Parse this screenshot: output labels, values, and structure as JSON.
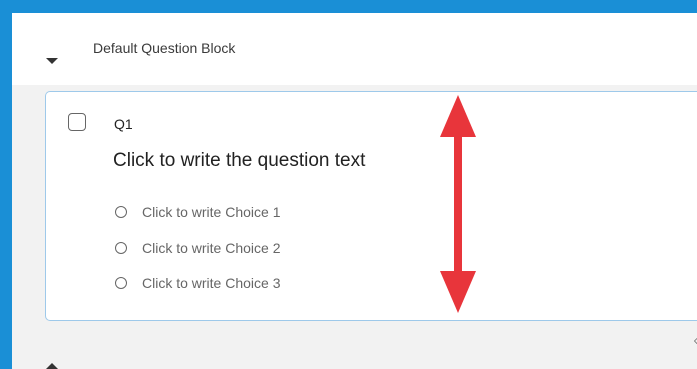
{
  "block": {
    "title": "Default Question Block",
    "collapse_icon": "chevron-down-icon",
    "next_block_icon": "chevron-up-icon"
  },
  "question": {
    "id": "Q1",
    "text": "Click to write the question text",
    "choices": [
      {
        "label": "Click to write Choice 1"
      },
      {
        "label": "Click to write Choice 2"
      },
      {
        "label": "Click to write Choice 3"
      }
    ]
  },
  "annotation": {
    "icon": "vertical-double-arrow-icon",
    "color": "#e8353b"
  },
  "colors": {
    "frame": "#1a8fd6",
    "card_border": "#9ec9ea"
  }
}
